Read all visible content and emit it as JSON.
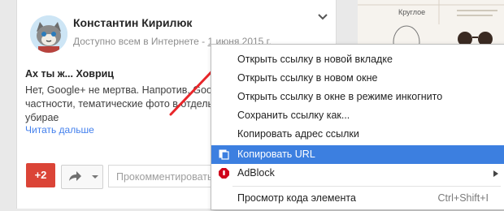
{
  "post": {
    "author": "Константин Кирилюк",
    "visibility": "Доступно всем в Интернете",
    "separator": " - ",
    "date": "1 июня 2015 г.",
    "title": "Ах ты ж... Ховриц",
    "body": "Нет, Google+ не мертва. Напротив, Google+ функционал, в частности, тематические фото в отдельные приложения и убирае",
    "read_more": "Читать дальше"
  },
  "actions": {
    "plus_one": "+2",
    "comment_placeholder": "Прокомментировать"
  },
  "right_panel": {
    "label": "Круглое"
  },
  "context_menu": {
    "items": [
      {
        "label": "Открыть ссылку в новой вкладке"
      },
      {
        "label": "Открыть ссылку в новом окне"
      },
      {
        "label": "Открыть ссылку в окне в режиме инкогнито"
      },
      {
        "label": "Сохранить ссылку как..."
      },
      {
        "label": "Копировать адрес ссылки"
      },
      {
        "label": "Копировать URL"
      },
      {
        "label": "AdBlock"
      },
      {
        "label": "Просмотр кода элемента",
        "shortcut": "Ctrl+Shift+I"
      }
    ]
  },
  "colors": {
    "annotation_arrow": "#e8262a",
    "highlight": "#3c7fe0",
    "plus_one": "#db4437"
  }
}
